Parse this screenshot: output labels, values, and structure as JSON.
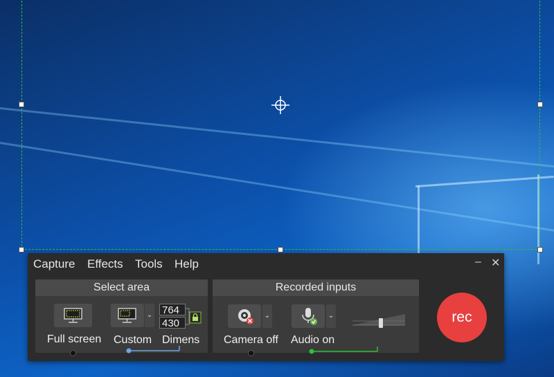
{
  "menu": {
    "capture": "Capture",
    "effects": "Effects",
    "tools": "Tools",
    "help": "Help"
  },
  "window_controls": {
    "minimize": "–",
    "close": "✕"
  },
  "select_area": {
    "header": "Select area",
    "full_screen_label": "Full screen",
    "custom_label": "Custom",
    "dimensions_label": "Dimens",
    "width": "764",
    "height": "430",
    "lock_icon": "lock-icon"
  },
  "recorded_inputs": {
    "header": "Recorded inputs",
    "camera_label": "Camera off",
    "audio_label": "Audio on",
    "camera_icon": "webcam-icon",
    "audio_icon": "microphone-icon"
  },
  "rec_label": "rec",
  "colors": {
    "accent_green": "#2fbf3a",
    "rec_red": "#e8403f",
    "selection_blue": "#6fa7e6"
  }
}
